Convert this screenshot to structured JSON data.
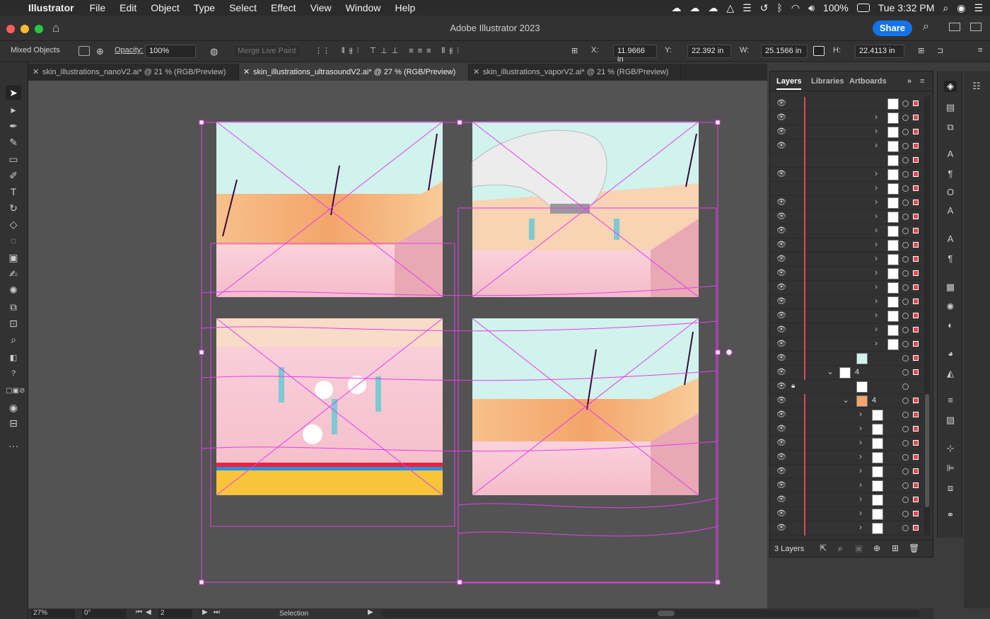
{
  "menubar": {
    "app_name": "Illustrator",
    "menus": [
      "File",
      "Edit",
      "Object",
      "Type",
      "Select",
      "Effect",
      "View",
      "Window",
      "Help"
    ],
    "battery": "100%",
    "clock": "Tue 3:32 PM"
  },
  "window": {
    "title": "Adobe Illustrator 2023",
    "share_label": "Share"
  },
  "control_bar": {
    "selection_type": "Mixed Objects",
    "opacity_label": "Opacity:",
    "opacity_value": "100%",
    "merge_live_paint": "Merge Live Paint",
    "x_label": "X:",
    "x_value": "11.9666 in",
    "y_label": "Y:",
    "y_value": "22.392 in",
    "w_label": "W:",
    "w_value": "25.1566 in",
    "h_label": "H:",
    "h_value": "22.4113 in"
  },
  "tabs": [
    {
      "label": "skin_illustrations_nanoV2.ai* @ 21 % (RGB/Preview)",
      "active": false
    },
    {
      "label": "skin_illustrations_ultrasoundV2.ai* @ 27 % (RGB/Preview)",
      "active": true
    },
    {
      "label": "skin_illustrations_vaporV2.ai* @ 21 % (RGB/Preview)",
      "active": false
    }
  ],
  "status_bar": {
    "zoom": "27%",
    "rotation": "0°",
    "artboard_number": "2",
    "tool_name": "Selection"
  },
  "layers_panel": {
    "tabs": [
      "Layers",
      "Libraries",
      "Artboards"
    ],
    "sublayer_label_a": "4",
    "sublayer_label_b": "4",
    "footer_count": "3 Layers"
  },
  "colors": {
    "accent_blue": "#1473e6",
    "selection_magenta": "#e83bf0",
    "layer_red": "#e34850"
  },
  "icons": {
    "apple": "apple-icon",
    "home": "home-icon",
    "search": "search-icon"
  }
}
